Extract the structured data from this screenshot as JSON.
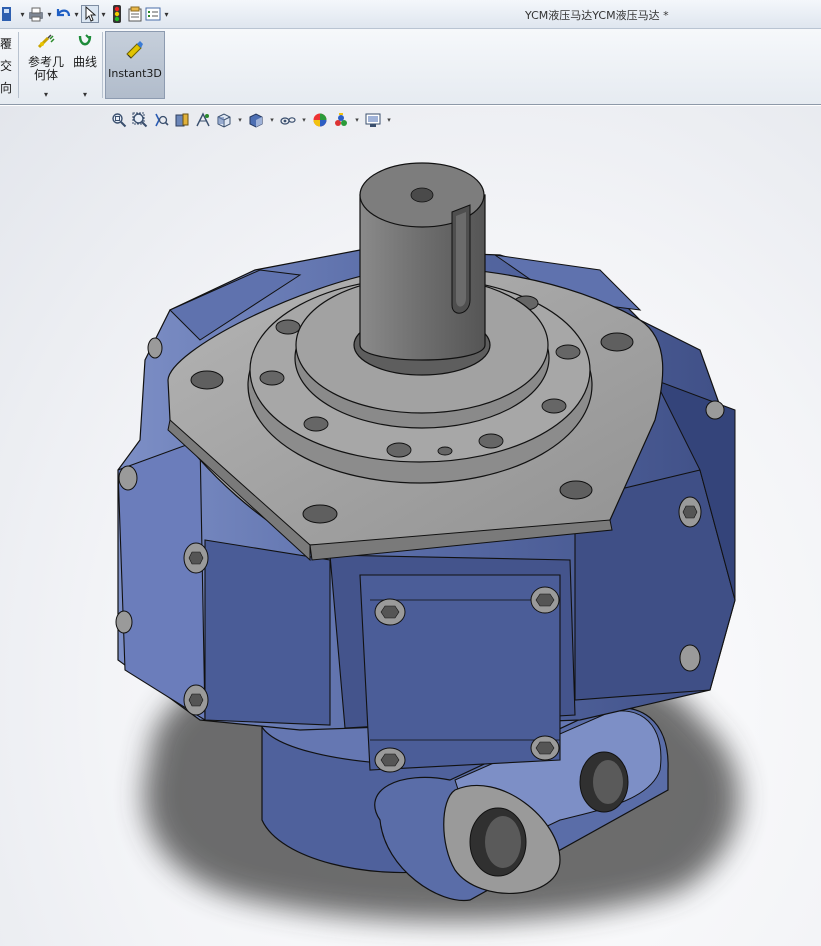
{
  "window": {
    "title": "YCM液压马达YCM液压马达 *"
  },
  "quick_access": {
    "icons": [
      "save-icon",
      "print-icon",
      "undo-icon",
      "select-arrow-icon",
      "rebuild-traffic-light-icon",
      "file-properties-icon",
      "options-icon"
    ],
    "dropdown_glyph": "▾"
  },
  "ribbon": {
    "left_partial_labels": [
      "覆",
      "交",
      "向"
    ],
    "buttons": [
      {
        "label_line1": "参考几",
        "label_line2": "何体",
        "icon": "reference-geometry-icon",
        "dropdown": "▾"
      },
      {
        "label_line1": "曲线",
        "label_line2": "",
        "icon": "curves-icon",
        "dropdown": "▾"
      }
    ],
    "instant3d": {
      "label": "Instant3D",
      "icon": "instant3d-icon",
      "active": true
    }
  },
  "view_toolbar": {
    "icons": [
      "zoom-to-fit-icon",
      "zoom-to-area-icon",
      "previous-view-icon",
      "section-view-icon",
      "dynamic-annotation-icon",
      "view-orientation-icon",
      "display-style-icon",
      "hide-show-items-icon",
      "edit-appearance-icon",
      "apply-scene-icon",
      "view-settings-icon"
    ],
    "dropdown_glyph": "▾"
  },
  "model": {
    "name": "hydraulic-motor",
    "colors": {
      "body": "#5a6da8",
      "body_dark": "#3f4f86",
      "body_light": "#7d8fc6",
      "metal": "#9a9a9a",
      "metal_dark": "#6f6f6f",
      "metal_light": "#bdbdbd",
      "shadow": "#4a4a4a"
    }
  }
}
